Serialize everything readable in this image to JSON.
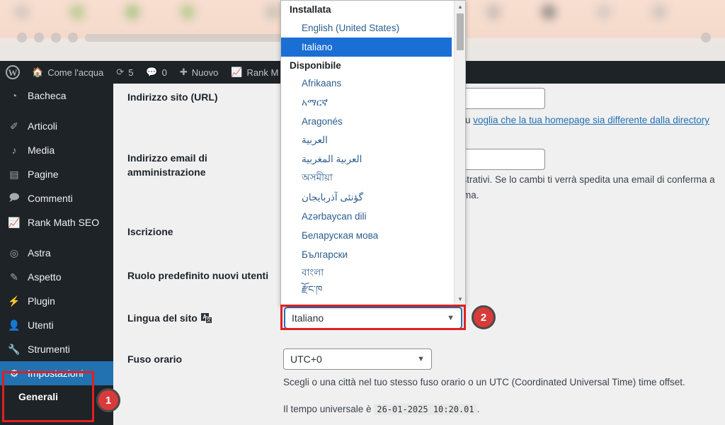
{
  "browser": {
    "tab_dot_colors": [
      "#b9b9b9",
      "#8fbf6a",
      "#7fb85e",
      "#8fbf6a",
      "#b0b0b0",
      "#a8a8a8",
      "#9aa8c0",
      "#d87a62",
      "#a9a9a9",
      "#5b6066",
      "#bdbdbd",
      "#b5b5b5"
    ]
  },
  "adminbar": {
    "logo_icon": "wordpress-logo-icon",
    "site_icon": "home-icon",
    "site_name": "Come l'acqua",
    "updates_icon": "updates-icon",
    "updates_count": "5",
    "comments_icon": "comment-icon",
    "comments_count": "0",
    "new_icon": "plus-icon",
    "new_label": "Nuovo",
    "rankmath_icon": "rank-math-icon",
    "rankmath_label": "Rank M"
  },
  "sidebar": {
    "items": [
      {
        "label": "Bacheca",
        "icon": "dashboard-icon",
        "current": false,
        "gap_after": true
      },
      {
        "label": "Articoli",
        "icon": "pin-icon",
        "current": false,
        "gap_after": false
      },
      {
        "label": "Media",
        "icon": "media-icon",
        "current": false,
        "gap_after": false
      },
      {
        "label": "Pagine",
        "icon": "page-icon",
        "current": false,
        "gap_after": false
      },
      {
        "label": "Commenti",
        "icon": "comment-icon",
        "current": false,
        "gap_after": false
      },
      {
        "label": "Rank Math SEO",
        "icon": "rank-math-icon",
        "current": false,
        "gap_after": true
      },
      {
        "label": "Astra",
        "icon": "astra-icon",
        "current": false,
        "gap_after": false
      },
      {
        "label": "Aspetto",
        "icon": "brush-icon",
        "current": false,
        "gap_after": false
      },
      {
        "label": "Plugin",
        "icon": "plug-icon",
        "current": false,
        "gap_after": false
      },
      {
        "label": "Utenti",
        "icon": "user-icon",
        "current": false,
        "gap_after": false
      },
      {
        "label": "Strumenti",
        "icon": "wrench-icon",
        "current": false,
        "gap_after": false
      },
      {
        "label": "Impostazioni",
        "icon": "settings-icon",
        "current": true,
        "gap_after": false
      }
    ],
    "submenu": [
      {
        "label": "Generali",
        "current": true
      }
    ]
  },
  "settings": {
    "site_url": {
      "label": "Indirizzo sito (URL)",
      "value": "",
      "help_visible": "e tu ",
      "help_link": "voglia che la tua homepage sia differente dalla directory"
    },
    "admin_email": {
      "label_line1": "Indirizzo email di",
      "label_line2": "amministrazione",
      "value": "",
      "help_line1": "nistrativi. Se lo cambi ti verrà spedita una email di conferma a",
      "help_line2": "erma."
    },
    "membership": {
      "label": "Iscrizione"
    },
    "default_role": {
      "label": "Ruolo predefinito nuovi utenti"
    },
    "site_language": {
      "label": "Lingua del sito",
      "icon": "translate-icon",
      "icon_letter_a": "A",
      "icon_letter_b": "文",
      "value": "Italiano"
    },
    "timezone": {
      "label": "Fuso orario",
      "value": "UTC+0",
      "help": "Scegli o una città nel tuo stesso fuso orario o un UTC (Coordinated Universal Time) time offset.",
      "utc_prefix": "Il tempo universale è",
      "utc_value": "26-01-2025 10:20.01",
      "utc_suffix": "."
    }
  },
  "language_dropdown": {
    "scroll_up_icon": "chevron-up-icon",
    "scroll_down_icon": "chevron-down-icon",
    "groups": [
      {
        "label": "Installata",
        "options": [
          {
            "text": "English (United States)",
            "selected": false
          },
          {
            "text": "Italiano",
            "selected": true
          }
        ]
      },
      {
        "label": "Disponibile",
        "options": [
          {
            "text": "Afrikaans",
            "selected": false
          },
          {
            "text": "አማርኛ",
            "selected": false
          },
          {
            "text": "Aragonés",
            "selected": false
          },
          {
            "text": "العربية",
            "selected": false
          },
          {
            "text": "العربية المغربية",
            "selected": false
          },
          {
            "text": "অসমীয়া",
            "selected": false
          },
          {
            "text": "گؤنئی آذربایجان",
            "selected": false
          },
          {
            "text": "Azərbaycan dili",
            "selected": false
          },
          {
            "text": "Беларуская мова",
            "selected": false
          },
          {
            "text": "Български",
            "selected": false
          },
          {
            "text": "বাংলা",
            "selected": false
          },
          {
            "text": "རྫོང་ཁ",
            "selected": false
          }
        ]
      }
    ]
  },
  "annotations": {
    "badge_1": "1",
    "badge_2": "2",
    "accent_red": "#e02020",
    "badge_fill": "#d93a3a"
  }
}
